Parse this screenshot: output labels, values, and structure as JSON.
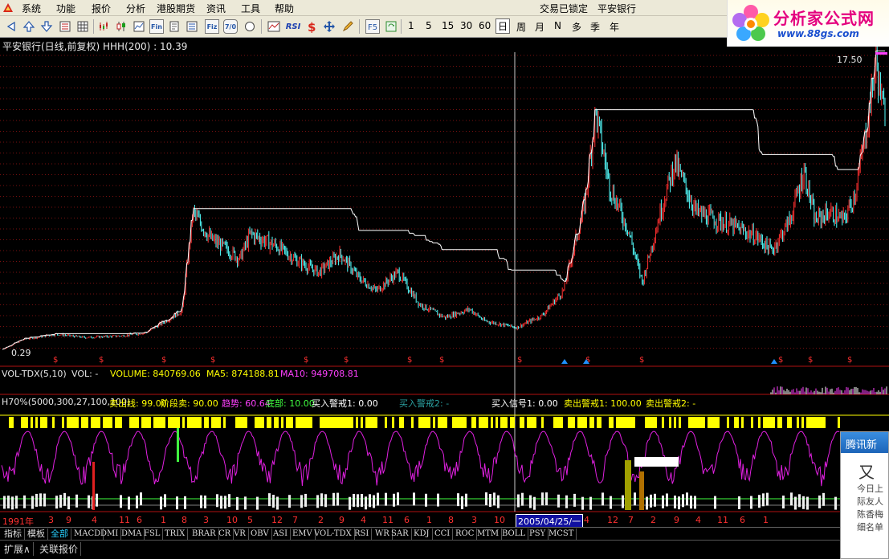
{
  "menu": {
    "items": [
      "系统",
      "功能",
      "报价",
      "分析",
      "港股期货",
      "资讯",
      "工具",
      "帮助"
    ],
    "status": "交易已锁定",
    "stock": "平安银行"
  },
  "brand": {
    "name": "分析家公式网",
    "url": "www.88gs.com"
  },
  "toolbar": {
    "periods": [
      "1",
      "5",
      "15",
      "30",
      "60",
      "日",
      "周",
      "月",
      "N",
      "多",
      "季",
      "年"
    ],
    "active_period": "日",
    "rsi_label": "RSI",
    "fund_labels": [
      "Fin",
      "Fiz",
      "7/0"
    ]
  },
  "price_panel": {
    "title": "平安银行(日线,前复权) HHH(200) : 10.39",
    "max_label": "17.50",
    "min_label": "0.29",
    "colors": {
      "up": "#ff3030",
      "down": "#54ffff",
      "hhh": "#ffffff"
    }
  },
  "volume_panel": {
    "name": "VOL-TDX(5,10)",
    "vol": "VOL: -",
    "volume": "VOLUME: 840769.06",
    "ma5": "MA5: 874188.81",
    "ma10": "MA10: 949708.81"
  },
  "indicator_panel": {
    "name": "H70%(5000,300,27,100,100)",
    "values": [
      {
        "text": "卖出线: 99.00",
        "color": "#ffff00"
      },
      {
        "text": "阶段卖: 90.00",
        "color": "#ffff00"
      },
      {
        "text": "趋势: 60.64",
        "color": "#ff40ff"
      },
      {
        "text": "底部: 10.00",
        "color": "#40ff40"
      },
      {
        "text": "买入警戒1: 0.00",
        "color": "#ffffff"
      },
      {
        "text": "买入警戒2: -",
        "color": "#2aa0a0"
      },
      {
        "text": "买入信号1: 0.00",
        "color": "#ffffff"
      },
      {
        "text": "卖出警戒1: 100.00",
        "color": "#ffff00"
      },
      {
        "text": "卖出警戒2: -",
        "color": "#ffff00"
      }
    ]
  },
  "time_axis": {
    "labels": [
      "1991年",
      "3",
      "9",
      "4",
      "11",
      "6",
      "1",
      "8",
      "3",
      "10",
      "5",
      "12",
      "7",
      "2",
      "9",
      "4",
      "11",
      "6",
      "1",
      "8",
      "3",
      "10",
      "2005/04/25/一",
      "4",
      "12",
      "7",
      "2",
      "9",
      "4",
      "11",
      "6",
      "1"
    ],
    "cursor_date": "2005/04/25/一"
  },
  "indicator_tabs": {
    "fixed": [
      "指标",
      "模板",
      "全部"
    ],
    "selected": "全部",
    "indicators": [
      "MACD",
      "DMI",
      "DMA",
      "FSL",
      "TRIX",
      "BRAR",
      "CR",
      "VR",
      "OBV",
      "ASI",
      "EMV",
      "VOL-TDX",
      "RSI",
      "WR",
      "SAR",
      "KDJ",
      "CCI",
      "ROC",
      "MTM",
      "BOLL",
      "PSY",
      "MCST"
    ]
  },
  "bottom_tabs": [
    "扩展∧",
    "关联报价"
  ],
  "popup": {
    "title": "腾讯新",
    "big_text": "又",
    "lines": [
      "今日上",
      "际友人",
      "陈香梅",
      "细名单"
    ]
  },
  "chart_data": {
    "type": "candlestick",
    "title": "平安银行(日线,前复权) HHH(200) : 10.39",
    "y_range": [
      0.29,
      17.5
    ],
    "highest": 17.5,
    "lowest": 0.29,
    "trend_points": [
      [
        1991.0,
        0.29
      ],
      [
        1991.6,
        0.9
      ],
      [
        1992.5,
        1.2
      ],
      [
        1993.3,
        1.0
      ],
      [
        1994.3,
        1.1
      ],
      [
        1995.0,
        1.3
      ],
      [
        1996.0,
        2.6
      ],
      [
        1996.3,
        8.5
      ],
      [
        1996.8,
        6.9
      ],
      [
        1997.3,
        6.2
      ],
      [
        1997.6,
        5.7
      ],
      [
        1997.9,
        7.2
      ],
      [
        1998.6,
        6.5
      ],
      [
        1999.2,
        5.6
      ],
      [
        1999.8,
        4.9
      ],
      [
        2000.4,
        6.0
      ],
      [
        2000.9,
        4.6
      ],
      [
        2001.4,
        3.8
      ],
      [
        2002.0,
        4.9
      ],
      [
        2002.6,
        3.0
      ],
      [
        2003.3,
        2.2
      ],
      [
        2004.0,
        2.7
      ],
      [
        2004.4,
        2.0
      ],
      [
        2005.3,
        1.6
      ],
      [
        2006.0,
        2.3
      ],
      [
        2006.6,
        3.8
      ],
      [
        2007.2,
        9.0
      ],
      [
        2007.5,
        14.5
      ],
      [
        2007.9,
        10.0
      ],
      [
        2008.4,
        7.5
      ],
      [
        2008.8,
        4.3
      ],
      [
        2009.3,
        8.5
      ],
      [
        2009.7,
        11.5
      ],
      [
        2010.3,
        8.5
      ],
      [
        2010.9,
        8.0
      ],
      [
        2011.5,
        7.5
      ],
      [
        2012.0,
        7.0
      ],
      [
        2012.4,
        6.2
      ],
      [
        2012.9,
        8.0
      ],
      [
        2013.3,
        11.0
      ],
      [
        2013.6,
        8.0
      ],
      [
        2014.0,
        8.5
      ],
      [
        2014.4,
        8.0
      ],
      [
        2014.7,
        9.5
      ],
      [
        2015.0,
        13.0
      ],
      [
        2015.3,
        17.5
      ],
      [
        2015.5,
        14.5
      ]
    ]
  }
}
